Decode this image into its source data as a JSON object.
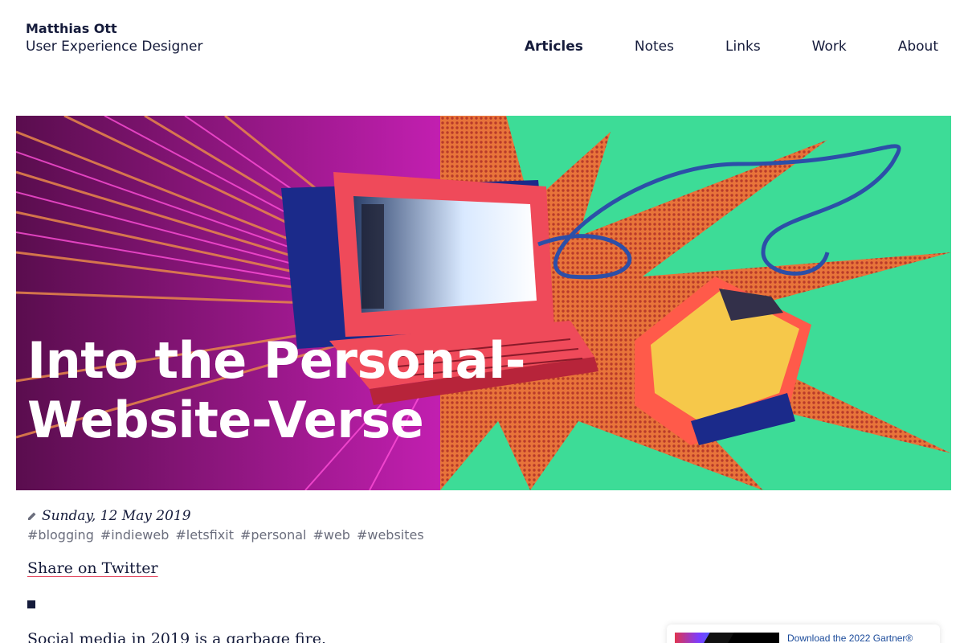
{
  "header": {
    "name": "Matthias Ott",
    "role": "User Experience Designer"
  },
  "nav": {
    "items": [
      {
        "label": "Articles",
        "active": true
      },
      {
        "label": "Notes",
        "active": false
      },
      {
        "label": "Links",
        "active": false
      },
      {
        "label": "Work",
        "active": false
      },
      {
        "label": "About",
        "active": false
      }
    ]
  },
  "hero": {
    "title_line1": "Into the Personal-",
    "title_line2": "Website-Verse",
    "image_icon": "retro-computer-illustration"
  },
  "meta": {
    "date_icon": "pencil-icon",
    "date": "Sunday, 12 May 2019",
    "tags": [
      "#blogging",
      "#indieweb",
      "#letsfixit",
      "#personal",
      "#web",
      "#websites"
    ]
  },
  "share": {
    "label": "Share on Twitter"
  },
  "article": {
    "intro": "Social media in 2019 is a garbage fire."
  },
  "ad": {
    "text": "Download the 2022 Gartner®"
  },
  "colors": {
    "text": "#151b3b",
    "tag": "#6b6e7d",
    "accent_underline": "#e0344f",
    "hero_green": "#3ddc97"
  }
}
